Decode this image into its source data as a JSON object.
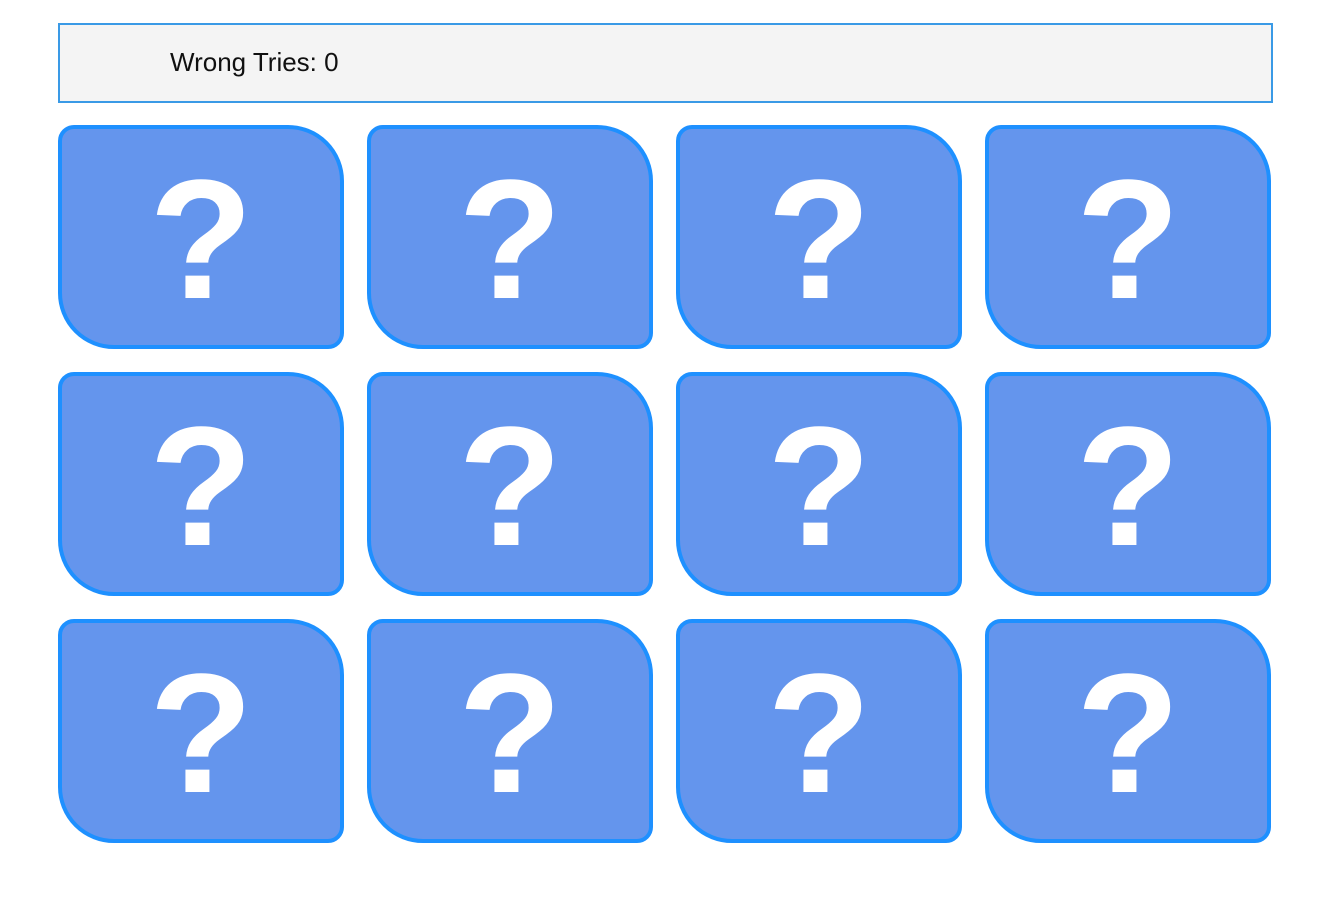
{
  "status": {
    "text": "Wrong Tries: 0"
  },
  "board": {
    "rows": 3,
    "columns": 4,
    "cards": [
      {
        "face": "?"
      },
      {
        "face": "?"
      },
      {
        "face": "?"
      },
      {
        "face": "?"
      },
      {
        "face": "?"
      },
      {
        "face": "?"
      },
      {
        "face": "?"
      },
      {
        "face": "?"
      },
      {
        "face": "?"
      },
      {
        "face": "?"
      },
      {
        "face": "?"
      },
      {
        "face": "?"
      }
    ]
  },
  "colors": {
    "card_fill": "#6495ed",
    "card_border": "#1e90ff",
    "status_border": "#3a9ae6",
    "status_fill": "#f4f4f4"
  }
}
